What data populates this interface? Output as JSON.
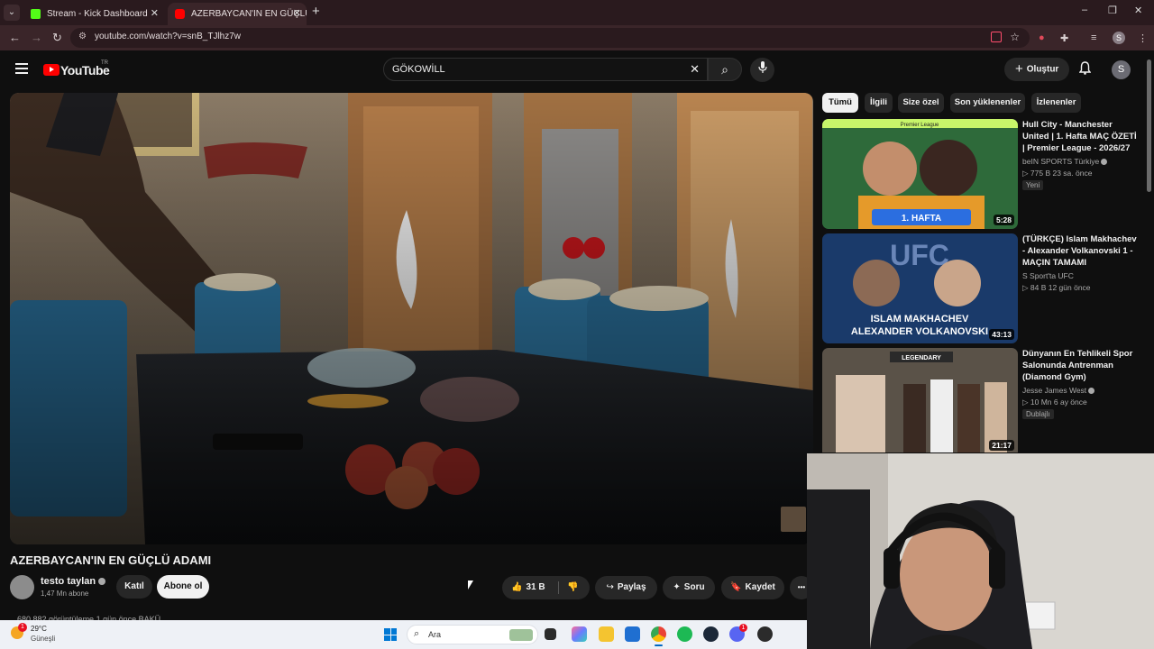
{
  "browser": {
    "tabs": [
      {
        "title": "Stream - Kick Dashboard",
        "favicon_color": "#53fc18",
        "active": false
      },
      {
        "title": "AZERBAYCAN'IN EN GÜÇLÜ AD",
        "favicon_color": "#ff0000",
        "active": true
      }
    ],
    "tab_close": "✕",
    "new_tab": "+",
    "url": "youtube.com/watch?v=snB_TJlhz7w",
    "profile_initial": "S",
    "window_controls": {
      "minimize": "–",
      "restore": "❐",
      "close": "✕"
    }
  },
  "youtube": {
    "logo_text": "YouTube",
    "logo_country": "TR",
    "search_value": "GÖKOWİLL",
    "create_label": "Oluştur",
    "avatar_initial": "S",
    "video": {
      "title": "AZERBAYCAN'IN EN GÜÇLÜ ADAMI",
      "channel": "testo taylan",
      "subscribers": "1,47 Mn abone",
      "join_label": "Katıl",
      "subscribe_label": "Abone ol",
      "likes": "31 B",
      "share_label": "Paylaş",
      "ask_label": "Soru",
      "save_label": "Kaydet",
      "more_label": "•••",
      "views_line": "680.882 görüntüleme  1 gün önce  BAKÜ"
    },
    "chips": [
      "Tümü",
      "İlgili",
      "Size özel",
      "Son yüklenenler",
      "İzlenenler"
    ],
    "recommendations": [
      {
        "title": "Hull City - Manchester United | 1. Hafta MAÇ ÖZETİ | Premier League - 2026/27",
        "channel": "beIN SPORTS Türkiye",
        "meta": "▷ 775 B  23 sa. önce",
        "badge": "Yeni",
        "duration": "5:28",
        "thumb_text": "1. HAFTA",
        "thumb_top_text": "Premier League"
      },
      {
        "title": "(TÜRKÇE) Islam Makhachev - Alexander Volkanovski 1 - MAÇIN TAMAMI",
        "channel": "S Sport'ta UFC",
        "meta": "▷ 84 B  12 gün önce",
        "badge": "",
        "duration": "43:13",
        "thumb_text": "ISLAM MAKHACHEV",
        "thumb_text2": "ALEXANDER VOLKANOVSKI",
        "thumb_top_text": "UFC"
      },
      {
        "title": "Dünyanın En Tehlikeli Spor Salonunda Antrenman (Diamond Gym)",
        "channel": "Jesse James West",
        "meta": "▷ 10 Mn  6 ay önce",
        "badge": "Dublajlı",
        "duration": "21:17",
        "thumb_top_text": "LEGENDARY"
      }
    ]
  },
  "taskbar": {
    "weather_temp": "29°C",
    "weather_desc": "Güneşli",
    "weather_badge": "1",
    "search_label": "Ara",
    "discord_badge": "1"
  },
  "colors": {
    "accent_red": "#ff0000",
    "yt_bg": "#0f0f0f",
    "chrome_tab_bg": "#2a1a1e",
    "chrome_addr_bg": "#3a2529"
  }
}
